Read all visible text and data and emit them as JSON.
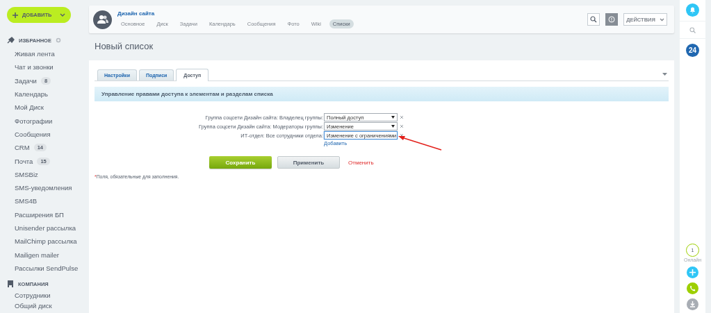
{
  "add_button": {
    "label": "ДОБАВИТЬ"
  },
  "sidebar": {
    "sections": [
      {
        "title": "ИЗБРАННОЕ",
        "items": [
          {
            "label": "Живая лента"
          },
          {
            "label": "Чат и звонки"
          },
          {
            "label": "Задачи",
            "badge": "8"
          },
          {
            "label": "Календарь"
          },
          {
            "label": "Мой Диск"
          },
          {
            "label": "Фотографии"
          },
          {
            "label": "Сообщения"
          },
          {
            "label": "CRM",
            "badge": "14"
          },
          {
            "label": "Почта",
            "badge": "15"
          },
          {
            "label": "SMSBiz"
          },
          {
            "label": "SMS-уведомления"
          },
          {
            "label": "SMS4B"
          },
          {
            "label": "Расширения БП"
          },
          {
            "label": "Unisender рассылка"
          },
          {
            "label": "MailChimp рассылка"
          },
          {
            "label": "Mailigen mailer"
          },
          {
            "label": "Рассылки SendPulse"
          }
        ]
      },
      {
        "title": "КОМПАНИЯ",
        "items": [
          {
            "label": "Сотрудники"
          },
          {
            "label": "Общий диск"
          }
        ]
      }
    ]
  },
  "group": {
    "name": "Дизайн сайта",
    "tabs": [
      {
        "label": "Основное",
        "selected": false
      },
      {
        "label": "Диск",
        "selected": false
      },
      {
        "label": "Задачи",
        "selected": false
      },
      {
        "label": "Календарь",
        "selected": false
      },
      {
        "label": "Сообщения",
        "selected": false
      },
      {
        "label": "Фото",
        "selected": false
      },
      {
        "label": "Wiki",
        "selected": false
      },
      {
        "label": "Списки",
        "selected": true
      }
    ]
  },
  "actions_button": {
    "label": "ДЕЙСТВИЯ"
  },
  "page_title": "Новый список",
  "form": {
    "tabs": [
      {
        "label": "Настройки",
        "selected": false
      },
      {
        "label": "Подписи",
        "selected": false
      },
      {
        "label": "Доступ",
        "selected": true
      }
    ],
    "section_title": "Управление правами доступа к элементам и разделам списка",
    "permissions": [
      {
        "label": "Группа соцсети Дизайн сайта: Владелец группы:",
        "value": "Полный доступ",
        "focused": false
      },
      {
        "label": "Группа соцсети Дизайн сайта: Модераторы группы:",
        "value": "Изменение",
        "focused": false
      },
      {
        "label": "ИТ-отдел: Все сотрудники отдела:",
        "value": "Изменение с ограничениями",
        "focused": true
      }
    ],
    "add_link": "Добавить",
    "save_button": "Сохранить",
    "apply_button": "Применить",
    "cancel_link": "Отменить",
    "note_mark": "*",
    "note": "Поля, обязательные для заполнения."
  },
  "right_bar": {
    "counter": "24",
    "online_count": "1",
    "online_label": "Онлайн"
  }
}
